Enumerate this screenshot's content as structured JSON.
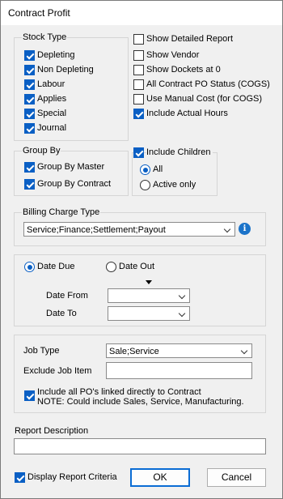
{
  "window": {
    "title": "Contract Profit"
  },
  "stock_type": {
    "label": "Stock Type",
    "items": [
      {
        "label": "Depleting",
        "checked": true
      },
      {
        "label": "Non Depleting",
        "checked": true
      },
      {
        "label": "Labour",
        "checked": true
      },
      {
        "label": "Applies",
        "checked": true
      },
      {
        "label": "Special",
        "checked": true
      },
      {
        "label": "Journal",
        "checked": true
      }
    ]
  },
  "options": [
    {
      "label": "Show Detailed Report",
      "checked": false
    },
    {
      "label": "Show Vendor",
      "checked": false
    },
    {
      "label": "Show Dockets at 0",
      "checked": false
    },
    {
      "label": "All Contract PO Status (COGS)",
      "checked": false
    },
    {
      "label": "Use Manual Cost (for COGS)",
      "checked": false
    },
    {
      "label": "Include Actual Hours",
      "checked": true
    }
  ],
  "group_by": {
    "label": "Group By",
    "items": [
      {
        "label": "Group By Master",
        "checked": true
      },
      {
        "label": "Group By Contract",
        "checked": true
      }
    ]
  },
  "children": {
    "label": "Include Children",
    "checked": true,
    "radios": [
      {
        "label": "All",
        "selected": true
      },
      {
        "label": "Active only",
        "selected": false
      }
    ]
  },
  "billing": {
    "label": "Billing Charge Type",
    "value": "Service;Finance;Settlement;Payout",
    "info_icon": "i"
  },
  "date": {
    "radios": [
      {
        "label": "Date Due",
        "selected": true
      },
      {
        "label": "Date Out",
        "selected": false
      }
    ],
    "from_label": "Date From",
    "to_label": "Date To",
    "from_value": "",
    "to_value": ""
  },
  "job": {
    "type_label": "Job Type",
    "type_value": "Sale;Service",
    "exclude_label": "Exclude Job Item",
    "exclude_value": "",
    "include_po_line1": "Include all PO's linked directly to Contract",
    "include_po_line2": "NOTE: Could include Sales, Service, Manufacturing.",
    "include_po_checked": true
  },
  "report": {
    "description_label": "Report Description",
    "description_value": ""
  },
  "footer": {
    "display_criteria_label": "Display Report Criteria",
    "display_criteria_checked": true,
    "ok_label": "OK",
    "cancel_label": "Cancel"
  }
}
